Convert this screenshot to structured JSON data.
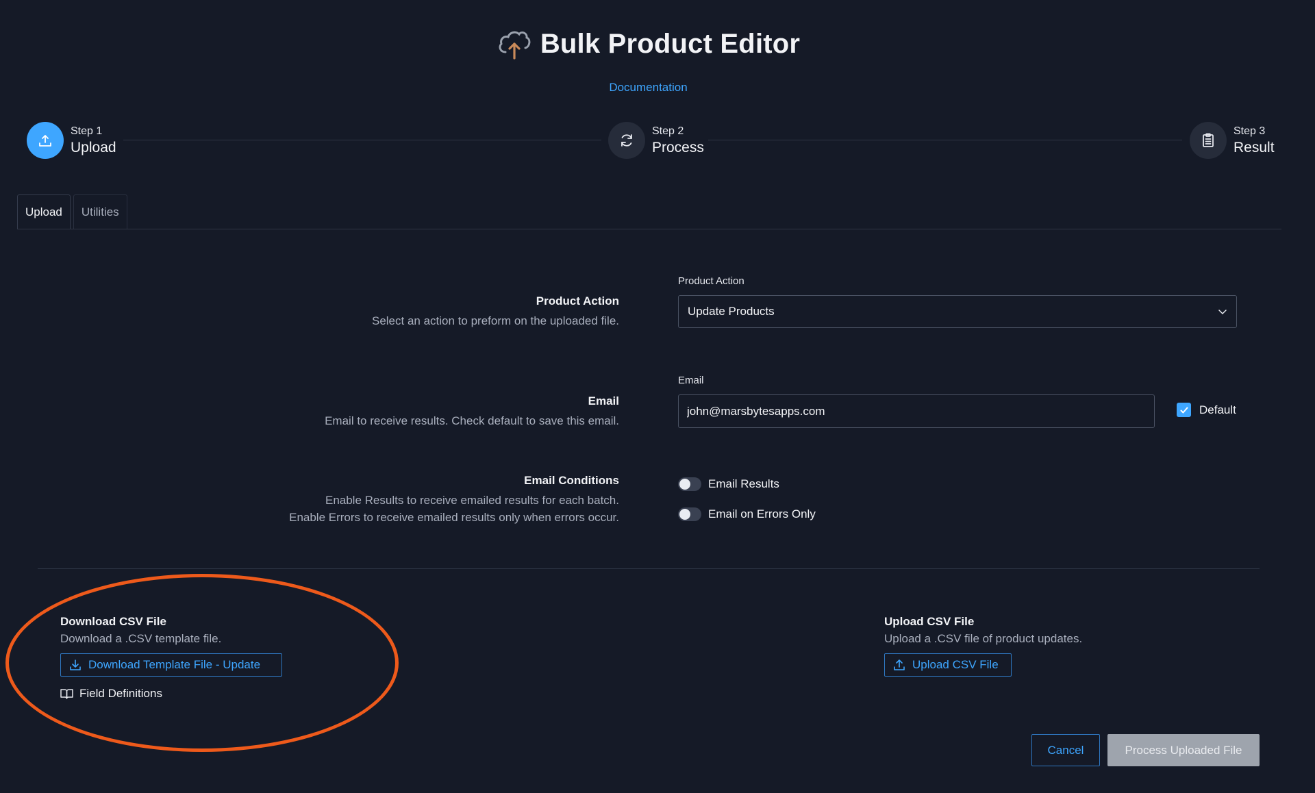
{
  "header": {
    "title": "Bulk Product Editor",
    "documentation_link": "Documentation",
    "logo_icon": "cloud-upload-icon"
  },
  "stepper": [
    {
      "step": "Step 1",
      "name": "Upload",
      "icon": "upload-icon",
      "active": true
    },
    {
      "step": "Step 2",
      "name": "Process",
      "icon": "refresh-icon",
      "active": false
    },
    {
      "step": "Step 3",
      "name": "Result",
      "icon": "clipboard-icon",
      "active": false
    }
  ],
  "tabs": [
    {
      "label": "Upload",
      "active": true
    },
    {
      "label": "Utilities",
      "active": false
    }
  ],
  "product_action": {
    "label": "Product Action",
    "description": "Select an action to preform on the uploaded file.",
    "field_label": "Product Action",
    "selected": "Update Products"
  },
  "email": {
    "label": "Email",
    "description": "Email to receive results. Check default to save this email.",
    "field_label": "Email",
    "value": "john@marsbytesapps.com",
    "default_label": "Default",
    "default_checked": true
  },
  "email_conditions": {
    "label": "Email Conditions",
    "description_1": "Enable Results to receive emailed results for each batch.",
    "description_2": "Enable Errors to receive emailed results only when errors occur.",
    "toggle_results": "Email Results",
    "toggle_errors": "Email on Errors Only"
  },
  "download": {
    "title": "Download CSV File",
    "description": "Download a .CSV template file.",
    "button": "Download Template File - Update",
    "field_definitions": "Field Definitions"
  },
  "upload": {
    "title": "Upload CSV File",
    "description": "Upload a .CSV file of product updates.",
    "button": "Upload CSV File"
  },
  "actions": {
    "cancel": "Cancel",
    "process": "Process Uploaded File"
  },
  "colors": {
    "background": "#151a27",
    "accent": "#3ea6ff",
    "annotation": "#ee5a1b",
    "disabled_button": "#9ea4ad"
  }
}
